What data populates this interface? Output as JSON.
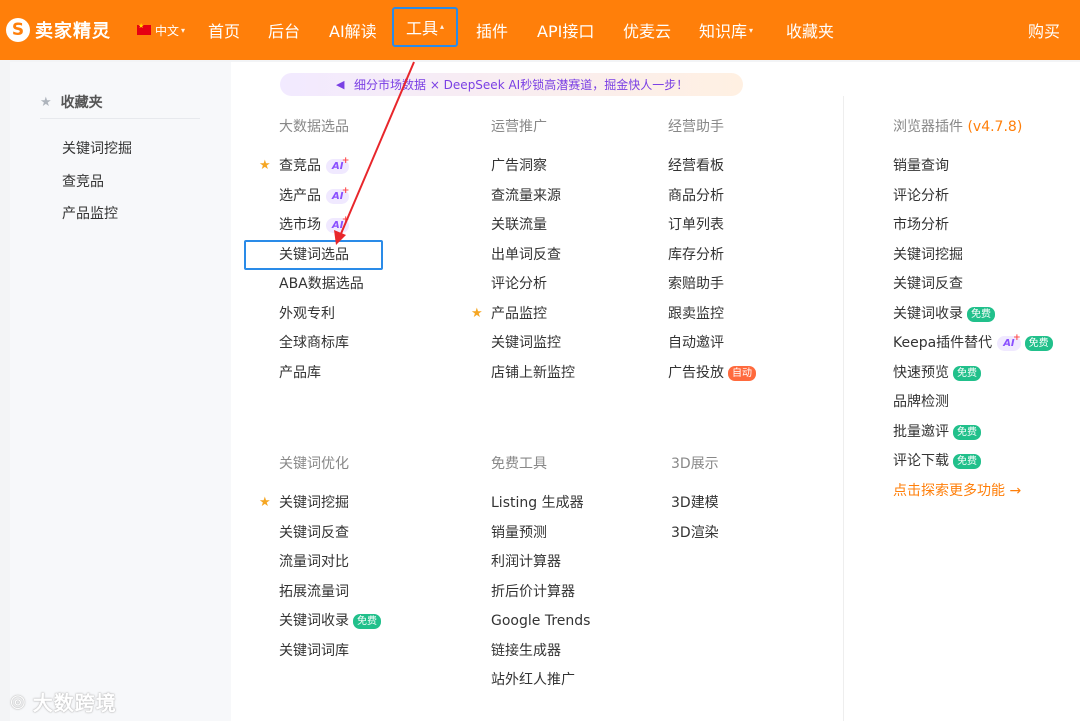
{
  "header": {
    "brand": "卖家精灵",
    "lang": "中文",
    "nav": [
      "首页",
      "后台",
      "AI解读",
      "工具",
      "插件",
      "API接口",
      "优麦云",
      "知识库",
      "收藏夹"
    ],
    "buy": "购买"
  },
  "sidebar": {
    "title": "收藏夹",
    "items": [
      "关键词挖掘",
      "查竞品",
      "产品监控"
    ]
  },
  "banner": {
    "text": "细分市场数据 × DeepSeek AI秒锁高潜赛道，掘金快人一步！"
  },
  "badges": {
    "ai": "AI",
    "free": "免费",
    "auto": "自动"
  },
  "menu": {
    "big_data": {
      "title": "大数据选品",
      "items": [
        "查竞品",
        "选产品",
        "选市场",
        "关键词选品",
        "ABA数据选品",
        "外观专利",
        "全球商标库",
        "产品库"
      ]
    },
    "operation": {
      "title": "运营推广",
      "items": [
        "广告洞察",
        "查流量来源",
        "关联流量",
        "出单词反查",
        "评论分析",
        "产品监控",
        "关键词监控",
        "店铺上新监控"
      ]
    },
    "assistant": {
      "title": "经营助手",
      "items": [
        "经营看板",
        "商品分析",
        "订单列表",
        "库存分析",
        "索赔助手",
        "跟卖监控",
        "自动邀评",
        "广告投放"
      ]
    },
    "plugin": {
      "title": "浏览器插件",
      "version": "(v4.7.8)",
      "items": [
        "销量查询",
        "评论分析",
        "市场分析",
        "关键词挖掘",
        "关键词反查",
        "关键词收录",
        "Keepa插件替代",
        "快速预览",
        "品牌检测",
        "批量邀评",
        "评论下载"
      ],
      "more": "点击探索更多功能 →"
    },
    "keyword": {
      "title": "关键词优化",
      "items": [
        "关键词挖掘",
        "关键词反查",
        "流量词对比",
        "拓展流量词",
        "关键词收录",
        "关键词词库"
      ]
    },
    "free_tools": {
      "title": "免费工具",
      "items": [
        "Listing 生成器",
        "销量预测",
        "利润计算器",
        "折后价计算器",
        "Google Trends",
        "链接生成器",
        "站外红人推广"
      ]
    },
    "three_d": {
      "title": "3D展示",
      "items": [
        "3D建模",
        "3D渲染"
      ]
    }
  },
  "watermark": "大数跨境"
}
